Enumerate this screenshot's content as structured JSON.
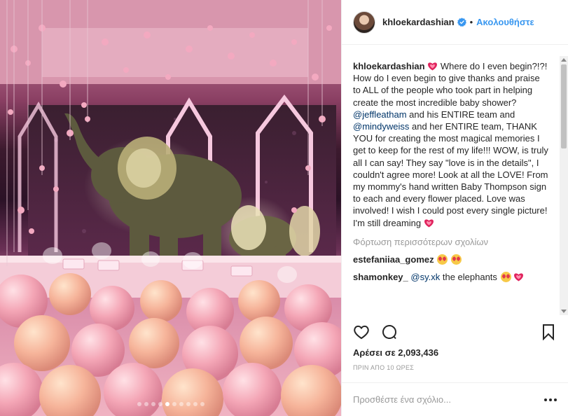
{
  "post": {
    "slide_count": 10,
    "active_slide": 5
  },
  "header": {
    "username": "khloekardashian",
    "bullet": "•",
    "follow_label": "Ακολουθήστε"
  },
  "caption": {
    "username": "khloekardashian",
    "text_1": " Where do I even begin?!?! How do I even begin to give thanks and praise to ALL of the people who took part in helping create the most incredible baby shower? ",
    "mention_1": "@jeffleatham",
    "text_2": " and his ENTIRE team and ",
    "mention_2": "@mindyweiss",
    "text_3": " and her ENTIRE team, THANK YOU for creating the most magical memories I get to keep for the rest of my life!!! WOW, is truly all I can say! They say \"love is in the details\", I couldn't agree more! Look at all the LOVE! From my mommy's hand written Baby Thompson sign to each and every flower placed. Love was involved! I wish I could post every single picture! I'm still dreaming "
  },
  "comments": {
    "load_more_label": "Φόρτωση περισσότερων σχολίων",
    "items": [
      {
        "username": "estefaniiaa_gomez",
        "mention": "",
        "text": ""
      },
      {
        "username": "shamonkey_",
        "mention": "@sy.xk",
        "text": " the elephants "
      }
    ]
  },
  "likes": {
    "text": "Αρέσει σε 2,093,436"
  },
  "timestamp": "ΠΡΙΝ ΑΠΟ 10 ΩΡΕΣ",
  "add_comment": {
    "placeholder": "Προσθέστε ένα σχόλιο..."
  },
  "icons": {
    "like": "heart-outline-icon",
    "comment": "comment-bubble-icon",
    "save": "bookmark-icon",
    "verified": "verified-badge-icon",
    "options": "more-options-icon"
  },
  "colors": {
    "link_blue": "#3897f0",
    "mention": "#003569",
    "muted": "#999999",
    "text": "#262626",
    "heart_red": "#e0245e"
  }
}
